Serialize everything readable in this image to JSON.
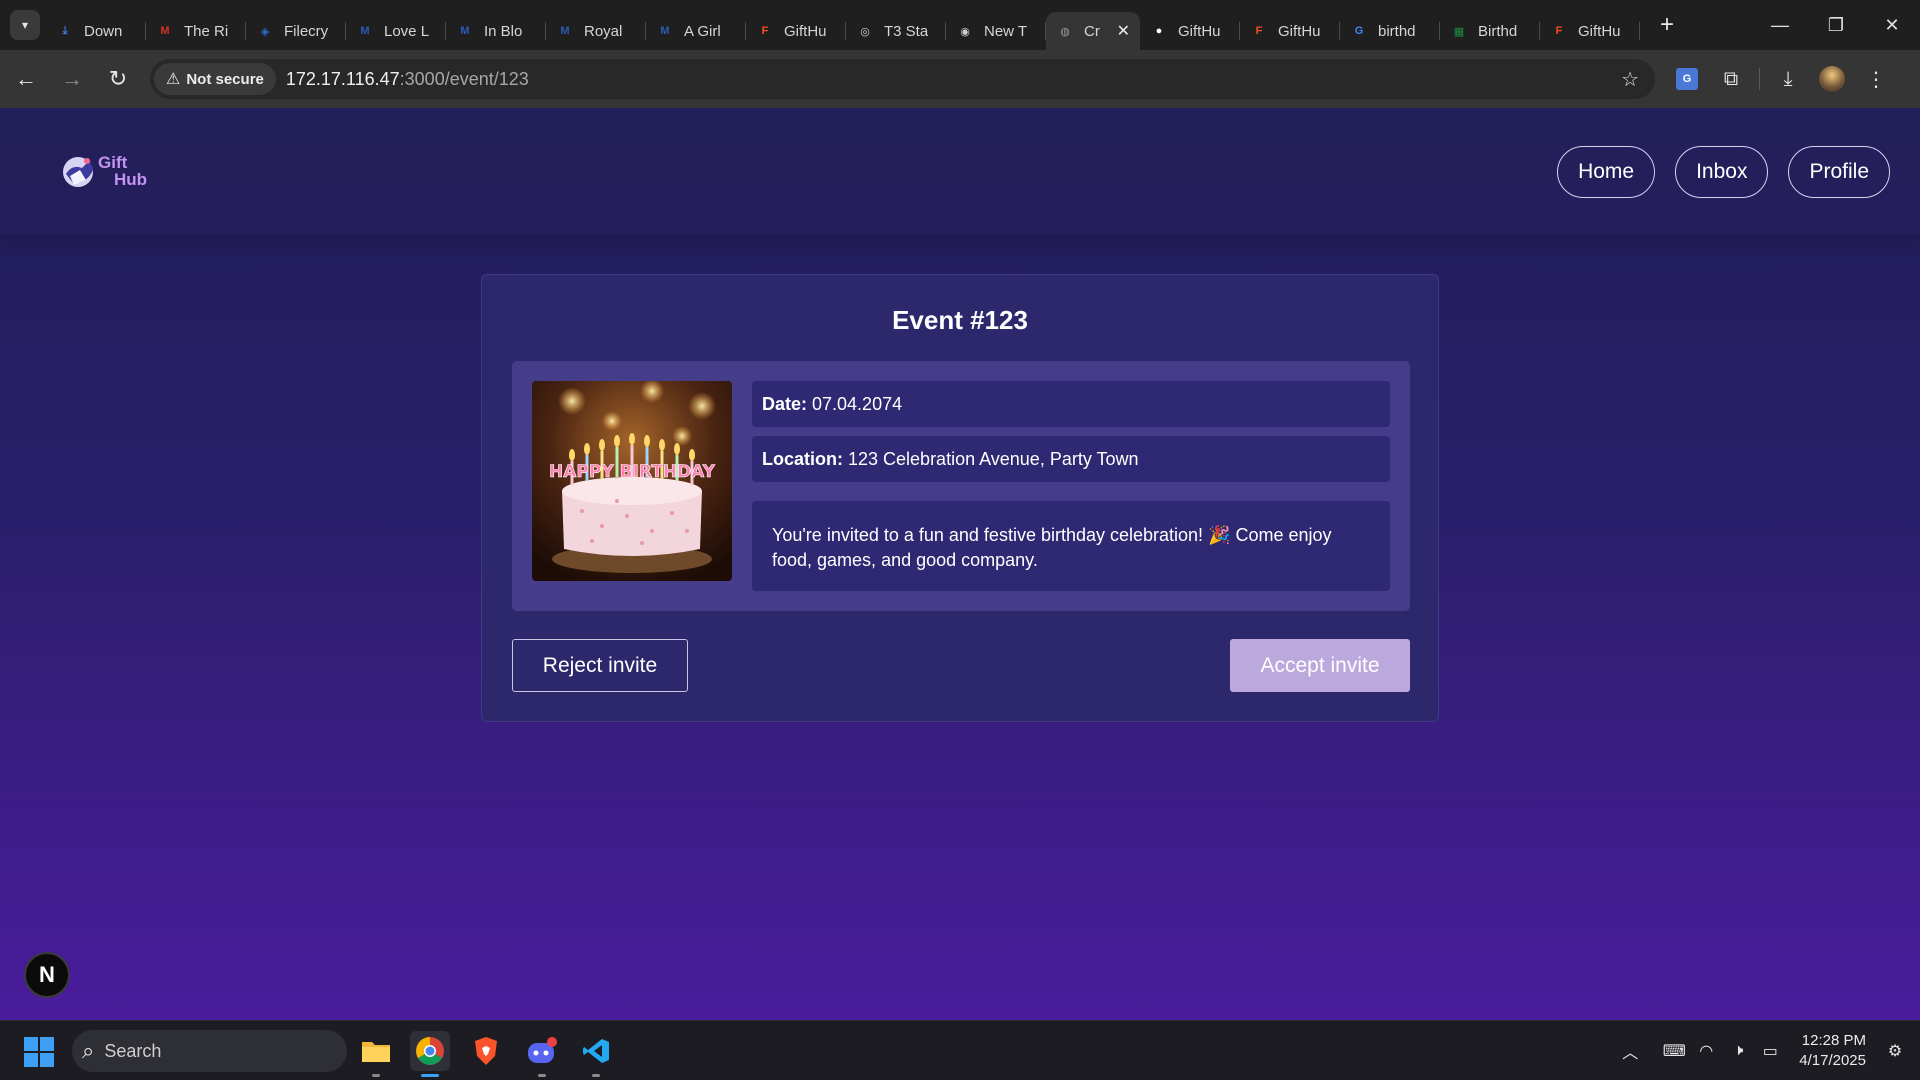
{
  "browser": {
    "tabs": [
      {
        "title": "Down",
        "icon": "download-icon",
        "color": "#3d7be0"
      },
      {
        "title": "The Ri",
        "icon": "gmail-icon",
        "color": "#d93025"
      },
      {
        "title": "Filecry",
        "icon": "shield-icon",
        "color": "#2b6fd6"
      },
      {
        "title": "Love L",
        "icon": "mdl-icon",
        "color": "#2b5bb8"
      },
      {
        "title": "In Blo",
        "icon": "mdl-icon",
        "color": "#2b5bb8"
      },
      {
        "title": "Royal",
        "icon": "mdl-icon",
        "color": "#2b5bb8"
      },
      {
        "title": "A Girl",
        "icon": "mdl-icon",
        "color": "#2b5bb8"
      },
      {
        "title": "GiftHu",
        "icon": "figma-icon",
        "color": "#f24e1e"
      },
      {
        "title": "T3 Sta",
        "icon": "openai-icon",
        "color": "#d0d0d0"
      },
      {
        "title": "New T",
        "icon": "chrome-icon",
        "color": "#d0d0d0"
      },
      {
        "title": "Cr",
        "icon": "globe-icon",
        "color": "#9a9a9a",
        "active": true
      },
      {
        "title": "GiftHu",
        "icon": "github-icon",
        "color": "#ffffff"
      },
      {
        "title": "GiftHu",
        "icon": "figma-icon",
        "color": "#f24e1e"
      },
      {
        "title": "birthd",
        "icon": "google-icon",
        "color": "#4285f4"
      },
      {
        "title": "Birthd",
        "icon": "sheets-icon",
        "color": "#1e8e3e"
      },
      {
        "title": "GiftHu",
        "icon": "figma-icon",
        "color": "#f24e1e"
      }
    ],
    "security_label": "Not secure",
    "url_host": "172.17.116.47",
    "url_path": ":3000/event/123"
  },
  "site": {
    "logo_line1": "Gift",
    "logo_line2": "Hub",
    "nav": {
      "home": "Home",
      "inbox": "Inbox",
      "profile": "Profile"
    }
  },
  "event": {
    "title": "Event #123",
    "date_label": "Date:",
    "date_value": "07.04.2074",
    "location_label": "Location:",
    "location_value": "123 Celebration Avenue, Party Town",
    "description": "You're invited to a fun and festive birthday celebration! 🎉 Come enjoy food, games, and good company.",
    "image_text": "HAPPY BIRTHDAY",
    "reject_label": "Reject invite",
    "accept_label": "Accept invite"
  },
  "dev_badge": "N",
  "taskbar": {
    "search_placeholder": "Search",
    "time": "12:28 PM",
    "date": "4/17/2025"
  }
}
